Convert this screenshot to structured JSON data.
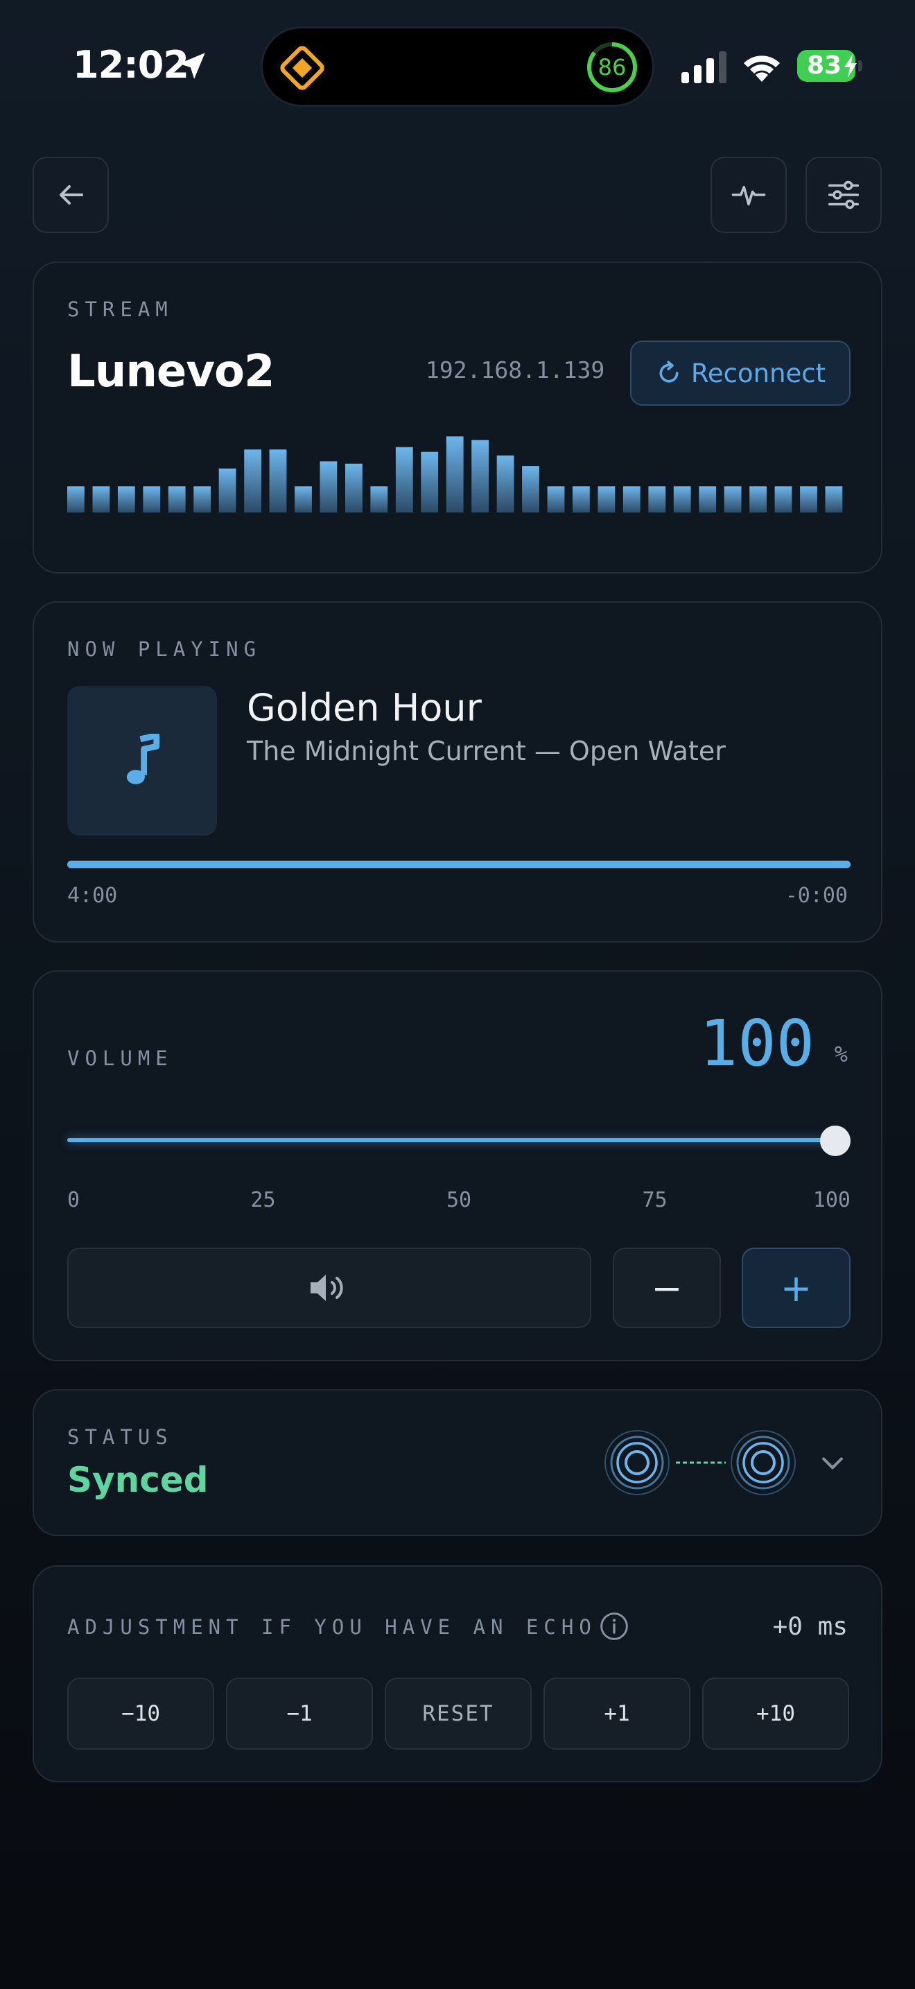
{
  "status_bar": {
    "time": "12:02",
    "island_badge": "86",
    "battery": "83"
  },
  "stream": {
    "label": "STREAM",
    "name": "Lunevo2",
    "ip": "192.168.1.139",
    "reconnect_label": "Reconnect",
    "visualizer_levels": [
      0.22,
      0.22,
      0.22,
      0.22,
      0.22,
      0.22,
      0.37,
      0.53,
      0.53,
      0.22,
      0.43,
      0.41,
      0.22,
      0.55,
      0.51,
      0.64,
      0.61,
      0.48,
      0.39,
      0.22,
      0.22,
      0.22,
      0.22,
      0.22,
      0.22,
      0.22,
      0.22,
      0.22,
      0.22,
      0.22,
      0.22
    ]
  },
  "now_playing": {
    "label": "NOW PLAYING",
    "title": "Golden Hour",
    "subtitle": "The Midnight Current — Open Water",
    "elapsed": "4:00",
    "remaining": "-0:00",
    "progress": 1.0
  },
  "volume": {
    "label": "VOLUME",
    "value": "100",
    "unit": "%",
    "level": 1.0,
    "ticks": [
      "0",
      "25",
      "50",
      "75",
      "100"
    ],
    "minus_label": "−",
    "plus_label": "+"
  },
  "status": {
    "label": "STATUS",
    "value": "Synced"
  },
  "echo": {
    "label": "ADJUSTMENT IF YOU HAVE AN ECHO",
    "value": "+0 ms",
    "buttons": [
      "−10",
      "−1",
      "RESET",
      "+1",
      "+10"
    ]
  },
  "colors": {
    "accent": "#5aaee8",
    "synced": "#5fd6a0",
    "battery": "#3fd053"
  }
}
